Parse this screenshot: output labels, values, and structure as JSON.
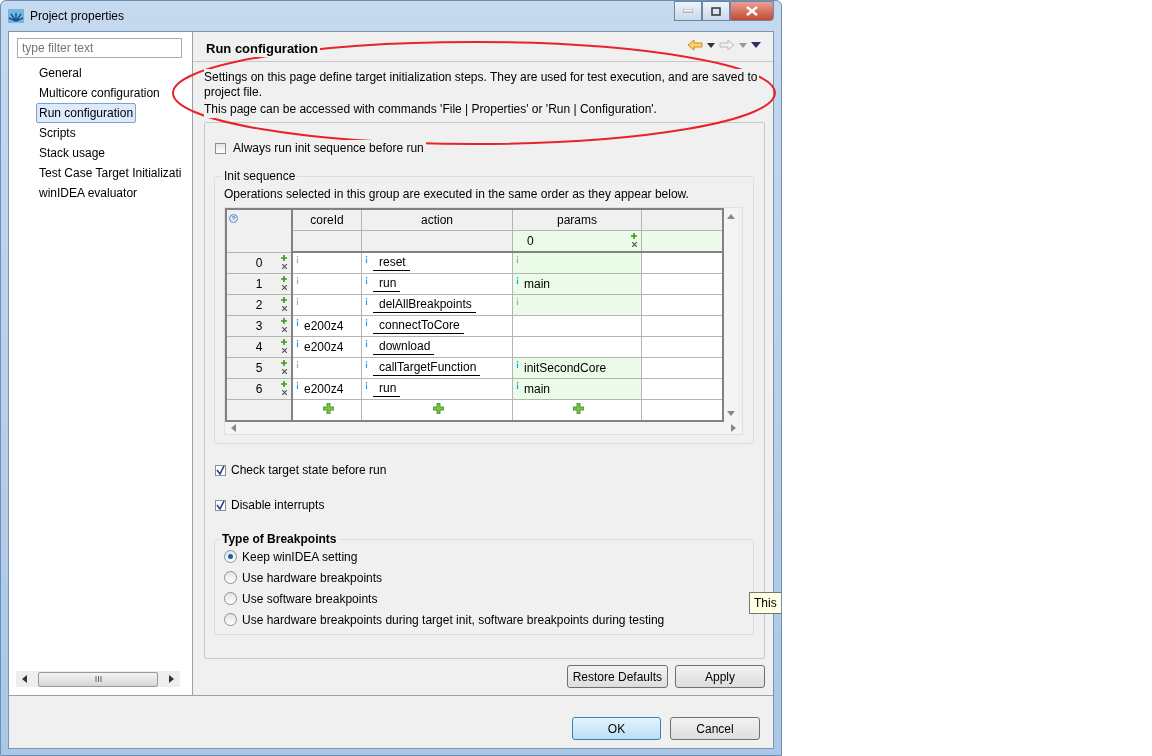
{
  "window": {
    "title": "Project properties"
  },
  "filter": {
    "placeholder": "type filter text"
  },
  "sidebar": {
    "items": [
      {
        "label": "General",
        "selected": false
      },
      {
        "label": "Multicore configuration",
        "selected": false
      },
      {
        "label": "Run configuration",
        "selected": true
      },
      {
        "label": "Scripts",
        "selected": false
      },
      {
        "label": "Stack usage",
        "selected": false
      },
      {
        "label": "Test Case Target Initializati",
        "selected": false
      },
      {
        "label": "winIDEA evaluator",
        "selected": false
      }
    ]
  },
  "page": {
    "title": "Run configuration",
    "description": [
      "Settings on this page define target initialization steps. They are used for test execution, and are saved to project file.",
      "This page can be accessed with commands 'File | Properties' or 'Run | Configuration'."
    ]
  },
  "always_run": {
    "label": "Always run init sequence before run",
    "checked": false
  },
  "init_sequence": {
    "title": "Init sequence",
    "note": "Operations selected in this group are executed in the same order as they appear below.",
    "table": {
      "columns": [
        "coreId",
        "action",
        "params"
      ],
      "params_subheader": "0",
      "rows": [
        {
          "index": "0",
          "coreId": "",
          "action": "reset",
          "params": "",
          "params_applicable": true
        },
        {
          "index": "1",
          "coreId": "",
          "action": "run",
          "params": "main",
          "params_applicable": true
        },
        {
          "index": "2",
          "coreId": "",
          "action": "delAllBreakpoints",
          "params": "",
          "params_applicable": true
        },
        {
          "index": "3",
          "coreId": "e200z4",
          "action": "connectToCore",
          "params": "",
          "params_applicable": false
        },
        {
          "index": "4",
          "coreId": "e200z4",
          "action": "download",
          "params": "",
          "params_applicable": false
        },
        {
          "index": "5",
          "coreId": "",
          "action": "callTargetFunction",
          "params": "initSecondCore",
          "params_applicable": true
        },
        {
          "index": "6",
          "coreId": "e200z4",
          "action": "run",
          "params": "main",
          "params_applicable": true
        }
      ]
    }
  },
  "check_state": {
    "label": "Check target state before run",
    "checked": true
  },
  "disable_interrupts": {
    "label": "Disable interrupts",
    "checked": true
  },
  "breakpoints": {
    "title": "Type of Breakpoints",
    "options": [
      {
        "label": "Keep winIDEA setting",
        "selected": true
      },
      {
        "label": "Use hardware breakpoints",
        "selected": false
      },
      {
        "label": "Use software breakpoints",
        "selected": false
      },
      {
        "label": "Use hardware breakpoints during target init, software breakpoints during testing",
        "selected": false
      }
    ]
  },
  "tooltip": "This",
  "buttons": {
    "restore": "Restore Defaults",
    "apply": "Apply",
    "ok": "OK",
    "cancel": "Cancel"
  }
}
